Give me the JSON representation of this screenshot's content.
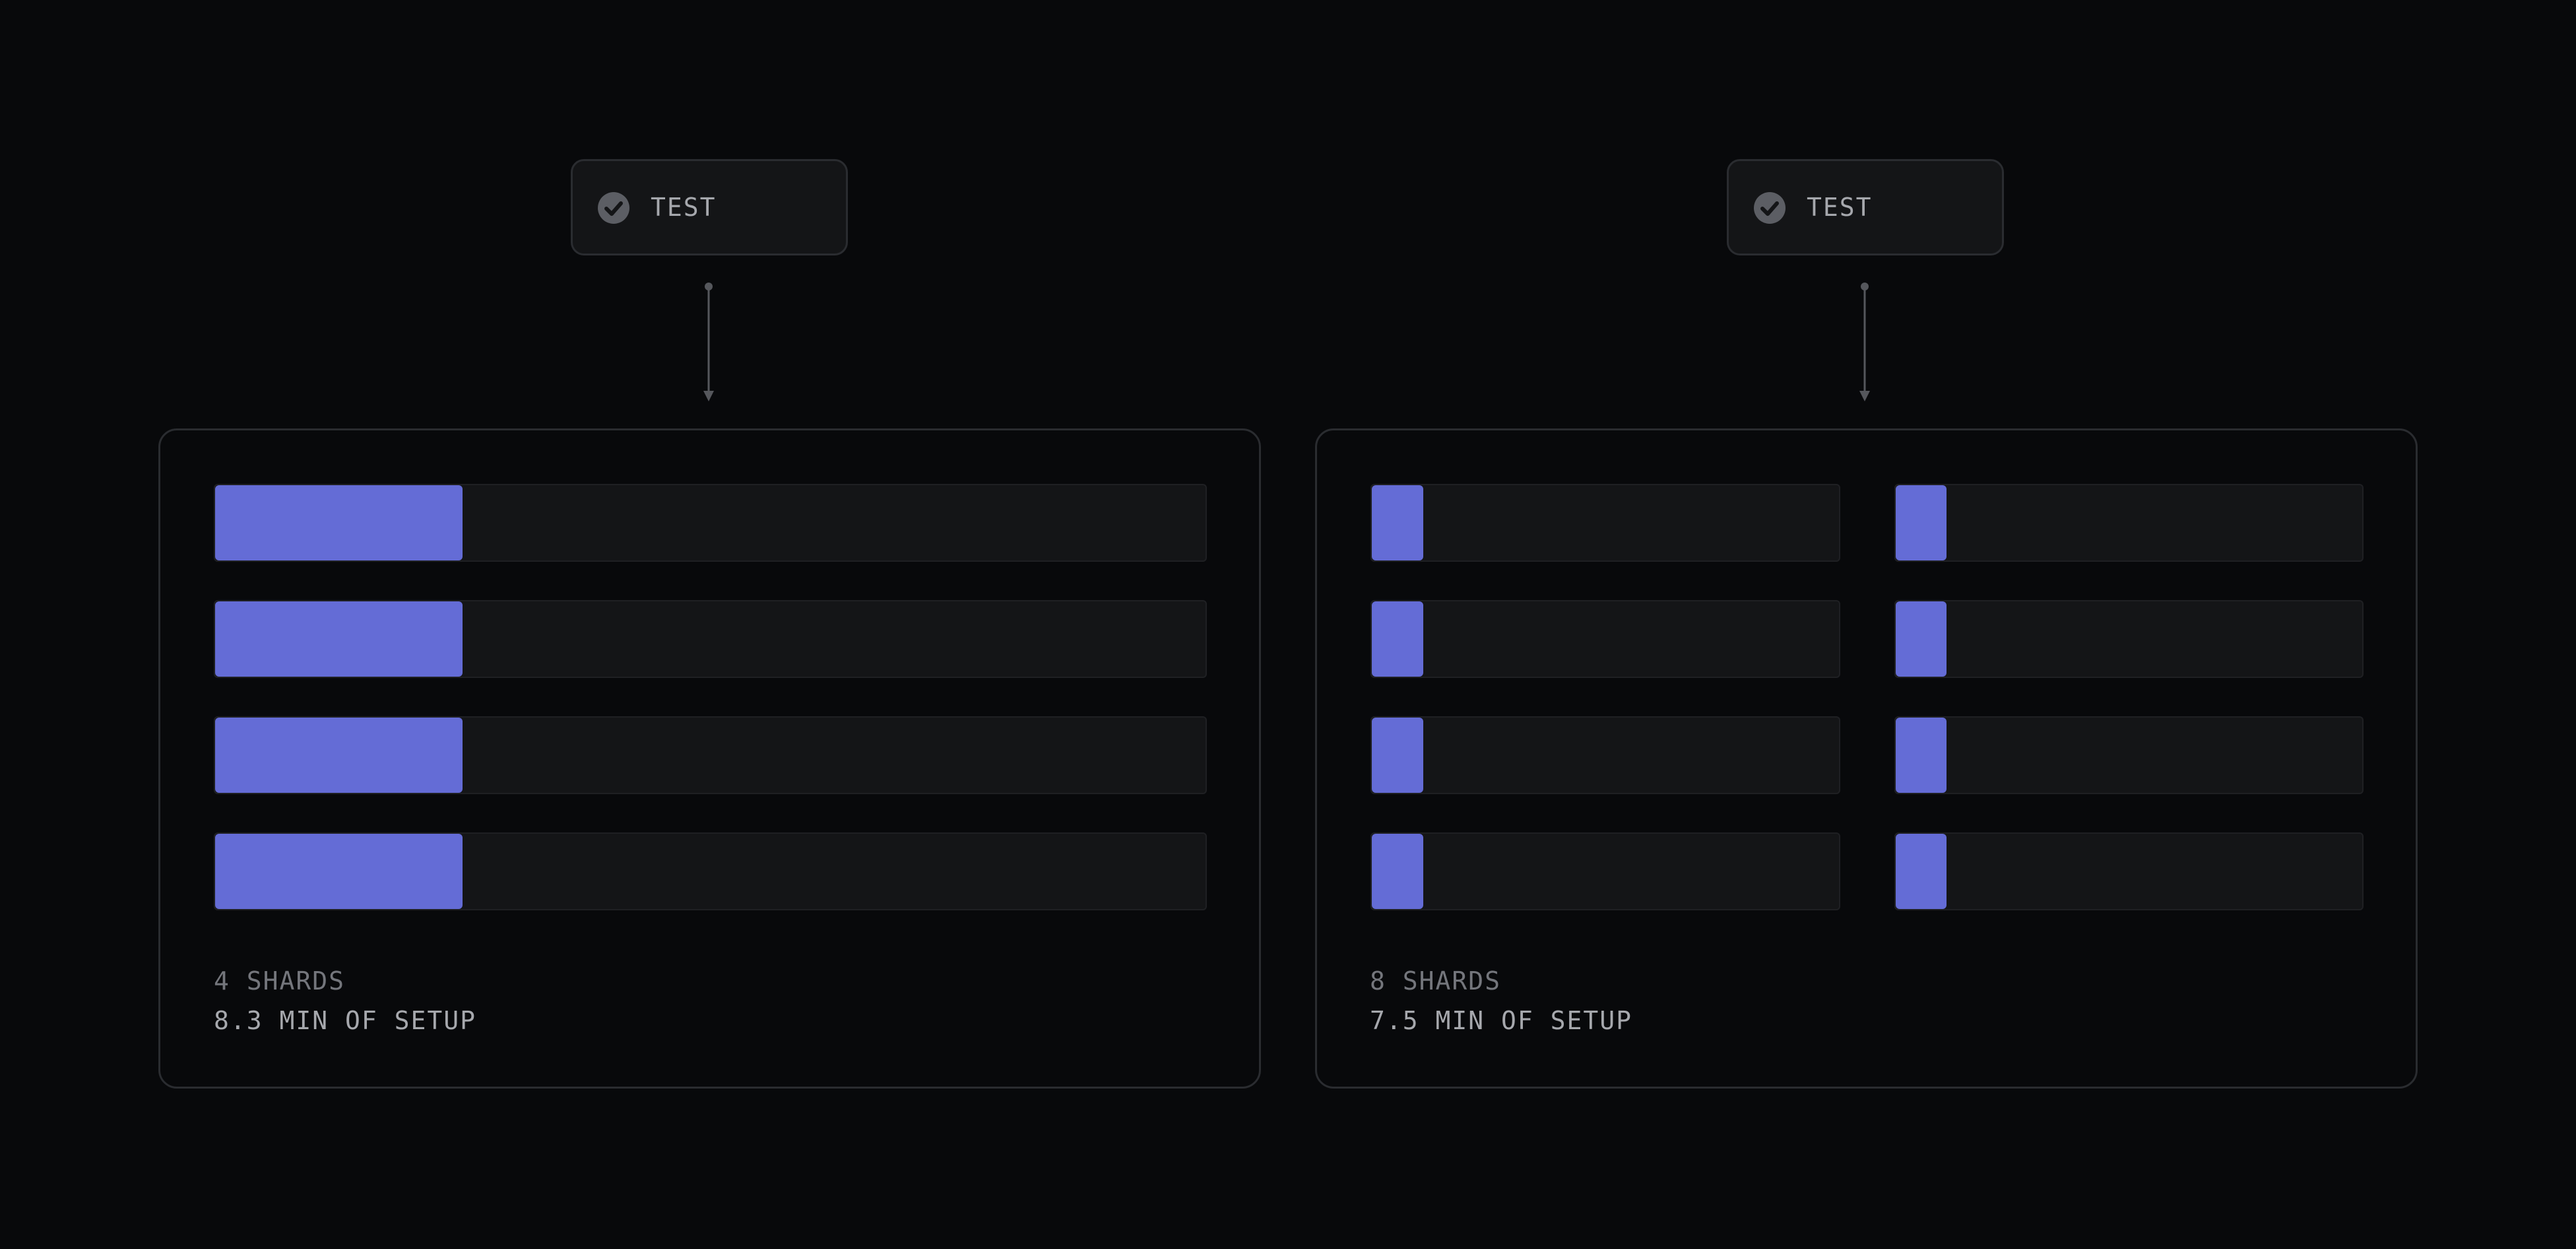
{
  "diagrams": [
    {
      "node_label": "TEST",
      "shards_label": "4 SHARDS",
      "setup_label": "8.3 MIN OF SETUP",
      "columns": 1,
      "shard_fill_fraction": [
        0.25,
        0.25,
        0.25,
        0.25
      ]
    },
    {
      "node_label": "TEST",
      "shards_label": "8 SHARDS",
      "setup_label": "7.5 MIN OF SETUP",
      "columns": 2,
      "shard_fill_fraction": [
        0.11,
        0.11,
        0.11,
        0.11,
        0.11,
        0.11,
        0.11,
        0.11
      ]
    }
  ],
  "colors": {
    "background": "#08090b",
    "node_fill": "#141517",
    "border": "#2a2c30",
    "track": "#141517",
    "bar_fill": "#646cd6",
    "text_muted": "#74767c",
    "text": "#a6a8ad",
    "connector": "#55575c"
  },
  "icons": {
    "node_status": "check-circle-icon"
  }
}
